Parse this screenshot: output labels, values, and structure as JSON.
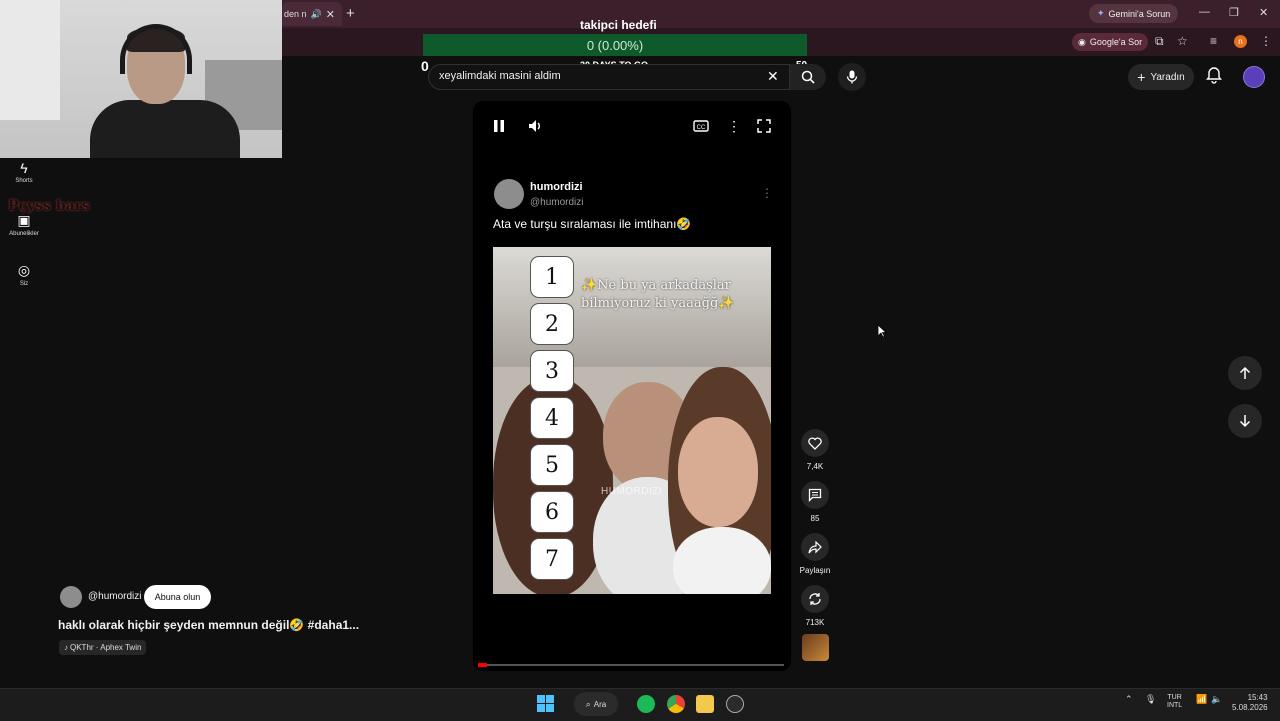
{
  "browser": {
    "tab_title": "den n",
    "gemini_label": "Gemini'a Sorun",
    "google_sor_label": "Google'a Sor"
  },
  "overlay": {
    "goal_title": "takipci hedefi",
    "goal_progress_text": "0 (0.00%)",
    "goal_progress_fraction": 0.0,
    "goal_left": "0",
    "goal_days": "30 DAYS TO GO",
    "goal_right": "50"
  },
  "masthead": {
    "search_query": "xeyalimdaki masini aldim",
    "create_label": "Yaradın"
  },
  "sidebar": {
    "items": [
      {
        "label": "Shorts",
        "icon": "shorts-icon"
      },
      {
        "label": "Abunelikler",
        "icon": "subscriptions-icon"
      },
      {
        "label": "Siz",
        "icon": "you-icon"
      }
    ],
    "overlap_logo_text": "Pçyss bars"
  },
  "post": {
    "name": "humordizi",
    "handle": "@humordizi",
    "caption": "Ata ve turşu sıralaması ile imtihanı🤣",
    "overlay_text": "✨Ne bu ya arkadaşlar bilmiyoruz ki yaaağğ✨",
    "ranks": [
      "1",
      "2",
      "3",
      "4",
      "5",
      "6",
      "7"
    ],
    "watermark": "HUMORDIZI"
  },
  "player": {
    "progress_fraction": 0.03
  },
  "actions": {
    "likes": "7,4K",
    "comments": "85",
    "share": "Paylaşın",
    "remix": "713K"
  },
  "channel": {
    "name": "@humordizi",
    "subscribe": "Abuna olun",
    "title": "haklı olarak hiçbir şeyden memnun değil🤣 #daha1...",
    "music": "QKThr · Aphex Twin"
  },
  "taskbar": {
    "search": "Ara",
    "lang_top": "TUR",
    "lang_bottom": "INTL",
    "time": "15:43",
    "date": "5.08.2026"
  },
  "colors": {
    "accent_red": "#ff0000",
    "goal_green": "#0e5a2a",
    "browser_frame": "#3b1f2b"
  }
}
